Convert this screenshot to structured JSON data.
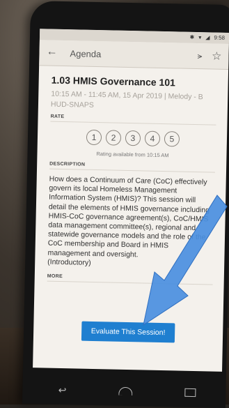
{
  "status_bar": {
    "time": "9:58",
    "icons": [
      "bluetooth-icon",
      "wifi-icon",
      "signal-icon"
    ]
  },
  "app_bar": {
    "title": "Agenda",
    "back_icon": "arrow-left-icon",
    "share_icon": "share-icon",
    "star_icon": "star-outline-icon"
  },
  "session": {
    "title": "1.03 HMIS Governance 101",
    "meta": "10:15 AM - 11:45 AM, 15 Apr 2019 | Melody - B",
    "track": "HUD-SNAPS"
  },
  "rate": {
    "label": "RATE",
    "options": [
      "1",
      "2",
      "3",
      "4",
      "5"
    ],
    "note": "Rating available from 10:15 AM"
  },
  "description": {
    "label": "DESCRIPTION",
    "text": "How does a Continuum of Care (CoC) effectively govern its local Homeless Management Information System (HMIS)? This session will detail the elements of HMIS governance including HMIS-CoC governance agreement(s), CoC/HMIS data management committee(s), regional and statewide governance models and the role of the CoC membership and Board in HMIS management and oversight.",
    "level": "(Introductory)"
  },
  "more": {
    "label": "MORE"
  },
  "evaluate": {
    "label": "Evaluate This Session!"
  },
  "colors": {
    "button": "#1f7fd0",
    "arrow": "#4a8fe0",
    "screen_bg": "#f4f1ec"
  }
}
